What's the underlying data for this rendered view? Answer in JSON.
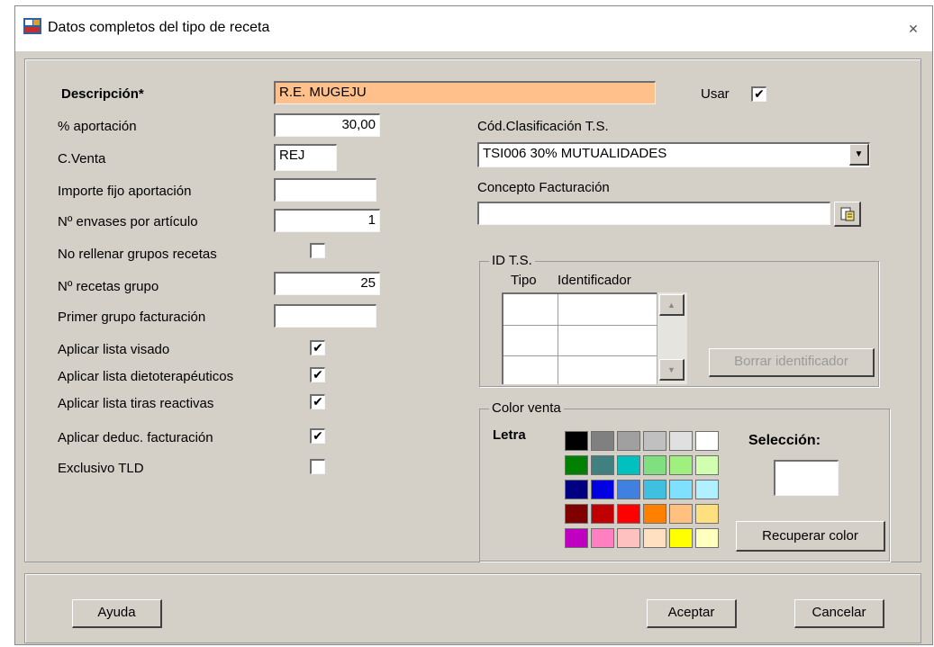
{
  "window": {
    "title": "Datos completos del tipo de receta",
    "close_glyph": "✕"
  },
  "form": {
    "descripcion_label": "Descripción*",
    "descripcion_value": "R.E. MUGEJU",
    "usar_label": "Usar",
    "usar_checked": "✔",
    "aportacion_label": "% aportación",
    "aportacion_value": "30,00",
    "cventa_label": "C.Venta",
    "cventa_value": "REJ",
    "importe_label": "Importe fijo aportación",
    "importe_value": "",
    "envases_label": "Nº envases por artículo",
    "envases_value": "1",
    "no_rellenar_label": "No rellenar grupos recetas",
    "no_rellenar_checked": "",
    "recetas_grupo_label": "Nº recetas grupo",
    "recetas_grupo_value": "25",
    "primer_grupo_label": "Primer grupo facturación",
    "primer_grupo_value": "",
    "visado_label": "Aplicar lista visado",
    "visado_checked": "✔",
    "dieto_label": "Aplicar lista dietoterapéuticos",
    "dieto_checked": "✔",
    "tiras_label": "Aplicar lista tiras reactivas",
    "tiras_checked": "✔",
    "deduc_label": "Aplicar deduc. facturación",
    "deduc_checked": "✔",
    "tld_label": "Exclusivo TLD",
    "tld_checked": ""
  },
  "clasificacion": {
    "label": "Cód.Clasificación T.S.",
    "value": "TSI006 30% MUTUALIDADES",
    "arrow": "▼"
  },
  "concepto": {
    "label": "Concepto Facturación",
    "value": ""
  },
  "id_ts": {
    "title": "ID T.S.",
    "col_tipo": "Tipo",
    "col_identificador": "Identificador",
    "borrar_button": "Borrar identificador",
    "scroll_up": "▲",
    "scroll_down": "▼"
  },
  "color": {
    "title": "Color venta",
    "letra_label": "Letra",
    "seleccion_label": "Selección:",
    "recuperar_button": "Recuperar color",
    "palette": [
      [
        "#000000",
        "#808080",
        "#a0a0a0",
        "#c0c0c0",
        "#e0e0e0",
        "#ffffff"
      ],
      [
        "#008000",
        "#408080",
        "#00c0c0",
        "#80e080",
        "#a0f080",
        "#d0ffb0"
      ],
      [
        "#000080",
        "#0000e0",
        "#4080e0",
        "#40c0e0",
        "#80e0ff",
        "#b0f0ff"
      ],
      [
        "#800000",
        "#c00000",
        "#ff0000",
        "#ff8000",
        "#ffc080",
        "#ffe080"
      ],
      [
        "#c000c0",
        "#ff80c0",
        "#ffc0c0",
        "#ffe0c0",
        "#ffff00",
        "#ffffc0"
      ]
    ]
  },
  "buttons": {
    "ayuda": "Ayuda",
    "aceptar": "Aceptar",
    "cancelar": "Cancelar"
  },
  "colors": {
    "description_bg": "#ffc08c",
    "dialog_bg": "#d4d0c8"
  }
}
